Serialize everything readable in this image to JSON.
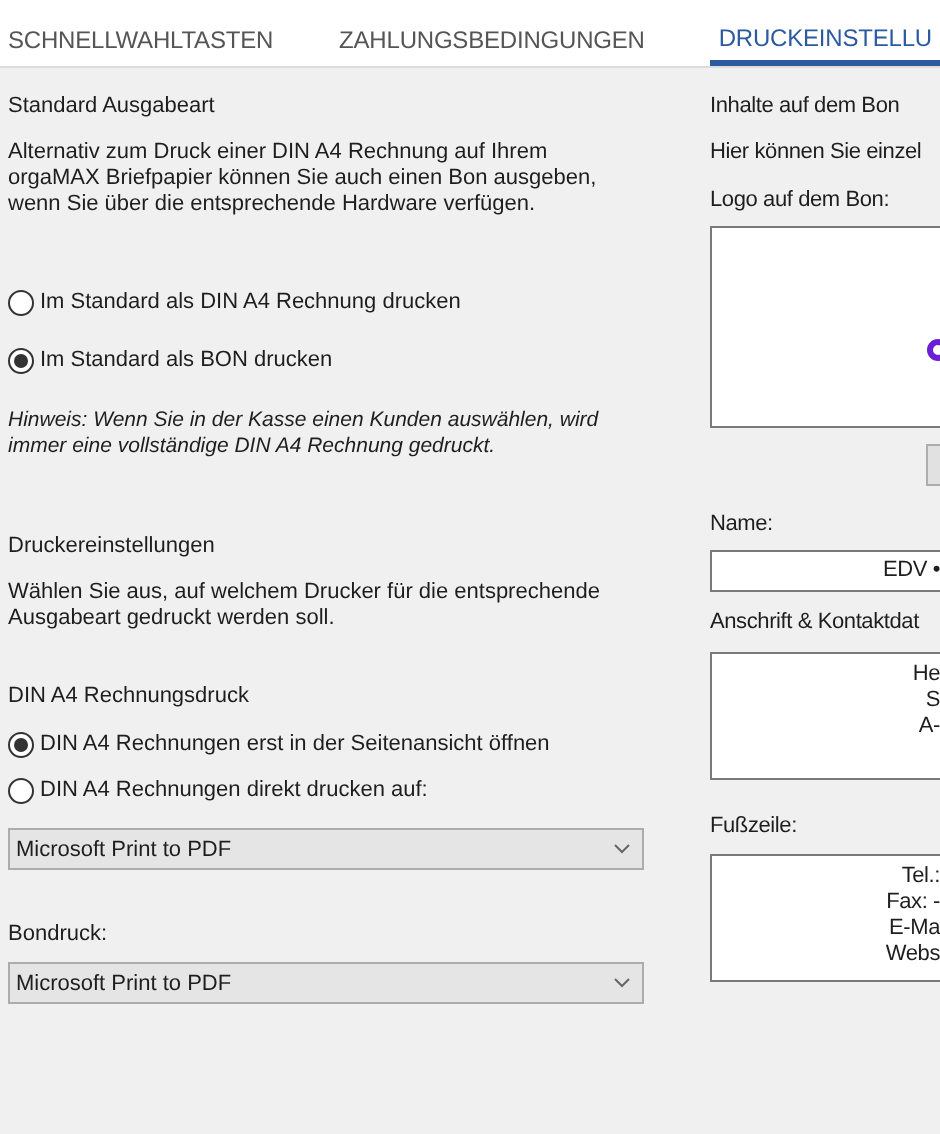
{
  "tabs": [
    {
      "label": "SCHNELLWAHLTASTEN",
      "selected": false
    },
    {
      "label": "ZAHLUNGSBEDINGUNGEN",
      "selected": false
    },
    {
      "label": "DRUCKEINSTELLU",
      "selected": true
    }
  ],
  "output_mode": {
    "heading": "Standard Ausgabeart",
    "description": "Alternativ zum Druck einer DIN A4 Rechnung auf Ihrem orgaMAX Briefpapier können Sie auch einen Bon ausgeben, wenn Sie über die entsprechende Hardware verfügen.",
    "options": [
      {
        "label": "Im Standard als DIN A4 Rechnung drucken",
        "selected": false
      },
      {
        "label": "Im Standard als BON drucken",
        "selected": true
      }
    ],
    "note": "Hinweis: Wenn Sie in der Kasse einen Kunden auswählen, wird immer eine vollständige DIN A4 Rechnung gedruckt."
  },
  "printer_settings": {
    "heading": "Druckereinstellungen",
    "description": "Wählen Sie aus, auf welchem Drucker für die entsprechende Ausgabeart gedruckt werden soll.",
    "a4_heading": "DIN A4 Rechnungsdruck",
    "a4_options": [
      {
        "label": "DIN A4 Rechnungen erst in der Seitenansicht öffnen",
        "selected": true
      },
      {
        "label": "DIN A4 Rechnungen direkt drucken auf:",
        "selected": false
      }
    ],
    "a4_printer": "Microsoft Print to PDF",
    "receipt_label": "Bondruck:",
    "receipt_printer": "Microsoft Print to PDF"
  },
  "receipt_content": {
    "heading": "Inhalte auf dem Bon",
    "description": "Hier können Sie einzel",
    "logo_label": "Logo auf dem Bon:",
    "name_label": "Name:",
    "name_value": "EDV •",
    "address_label": "Anschrift & Kontaktdat",
    "address_lines": [
      "He",
      "S",
      "A-"
    ],
    "footer_label": "Fußzeile:",
    "footer_lines": [
      "Tel.:",
      "Fax: -",
      "E-Ma",
      "Webs"
    ]
  }
}
